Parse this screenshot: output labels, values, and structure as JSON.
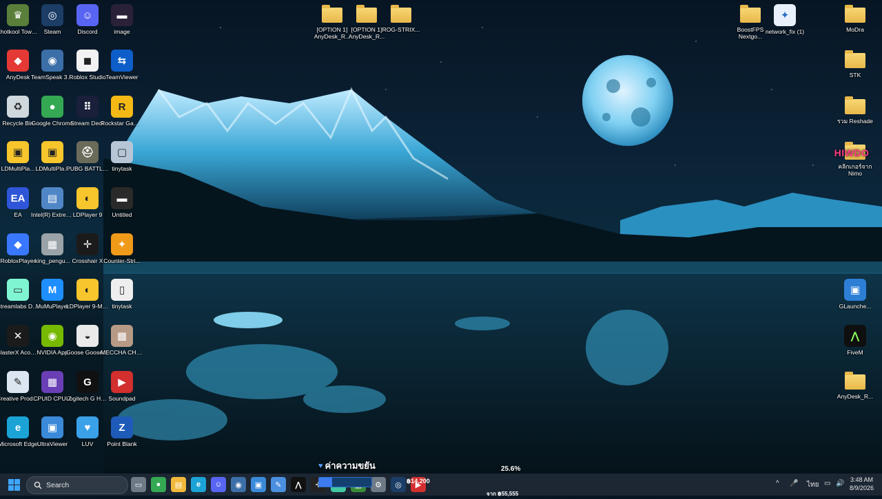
{
  "desktop_icons": [
    {
      "label": "Khotkool Town L...",
      "icon": "game-icon",
      "color": "#5a7f3a",
      "glyph": "♛"
    },
    {
      "label": "Steam",
      "icon": "steam-icon",
      "color": "#1b3d66",
      "glyph": "◎"
    },
    {
      "label": "Discord",
      "icon": "discord-icon",
      "color": "#5865f2",
      "glyph": "☺"
    },
    {
      "label": "image",
      "icon": "image-file-icon",
      "color": "#2a2138",
      "glyph": "▬"
    },
    {
      "label": "AnyDesk",
      "icon": "anydesk-icon",
      "color": "#e53935",
      "glyph": "◆"
    },
    {
      "label": "TeamSpeak 3 Client",
      "icon": "teamspeak-icon",
      "color": "#3c6fa8",
      "glyph": "◉"
    },
    {
      "label": "Roblox Studio",
      "icon": "roblox-studio-icon",
      "color": "#f2f2f2",
      "glyph": "◼"
    },
    {
      "label": "TeamViewer",
      "icon": "teamviewer-icon",
      "color": "#0e5ec9",
      "glyph": "⇆"
    },
    {
      "label": "Recycle Bin",
      "icon": "recycle-bin-icon",
      "color": "#cfd8dc",
      "glyph": "♻"
    },
    {
      "label": "Google Chrome",
      "icon": "chrome-icon",
      "color": "#34a853",
      "glyph": "●"
    },
    {
      "label": "Stream Deck",
      "icon": "stream-deck-icon",
      "color": "#1a1f3a",
      "glyph": "⠿"
    },
    {
      "label": "Rockstar Games...",
      "icon": "rockstar-icon",
      "color": "#f5b916",
      "glyph": "R"
    },
    {
      "label": "LDMultiPla...",
      "icon": "ldmultiplayer-icon",
      "color": "#f7c52c",
      "glyph": "▣"
    },
    {
      "label": "LDMultiPla...",
      "icon": "ldmultiplayer-icon",
      "color": "#f7c52c",
      "glyph": "▣"
    },
    {
      "label": "PUBG BATTLEGR...",
      "icon": "pubg-icon",
      "color": "#6b6b5a",
      "glyph": "⛑"
    },
    {
      "label": "tinytask",
      "icon": "tinytask-icon",
      "color": "#b6c6d6",
      "glyph": "▢"
    },
    {
      "label": "EA",
      "icon": "ea-icon",
      "color": "#2f56d8",
      "glyph": "EA"
    },
    {
      "label": "Intel(R) Extreme Tu...",
      "icon": "intel-xtu-icon",
      "color": "#4f86c6",
      "glyph": "▤"
    },
    {
      "label": "LDPlayer 9",
      "icon": "ldplayer-icon",
      "color": "#f7c52c",
      "glyph": "◐"
    },
    {
      "label": "Untitled",
      "icon": "image-file-icon",
      "color": "#2a2a2a",
      "glyph": "▬"
    },
    {
      "label": "RobloxPlayer",
      "icon": "roblox-icon",
      "color": "#3a77ff",
      "glyph": "◆"
    },
    {
      "label": "king_pengu...",
      "icon": "image-file-icon",
      "color": "#9aa3a8",
      "glyph": "▦"
    },
    {
      "label": "Crosshair X",
      "icon": "crosshair-icon",
      "color": "#1b1b1b",
      "glyph": "✛"
    },
    {
      "label": "Counter-Stri...",
      "icon": "counter-strike-icon",
      "color": "#f09a1a",
      "glyph": "✦"
    },
    {
      "label": "Streamlabs Desktop",
      "icon": "streamlabs-icon",
      "color": "#80f5d2",
      "glyph": "▭"
    },
    {
      "label": "MuMuPlayer",
      "icon": "mumu-icon",
      "color": "#1f8fff",
      "glyph": "M"
    },
    {
      "label": "LDPlayer 9-MoDra",
      "icon": "ldplayer-icon",
      "color": "#f7c52c",
      "glyph": "◐"
    },
    {
      "label": "tinytask",
      "icon": "file-icon",
      "color": "#eeeeee",
      "glyph": "▯"
    },
    {
      "label": "BlasterX Acoustic...",
      "icon": "blasterx-icon",
      "color": "#1b1b1b",
      "glyph": "✕"
    },
    {
      "label": "NVIDIA App",
      "icon": "nvidia-icon",
      "color": "#76b900",
      "glyph": "◉"
    },
    {
      "label": "Goose Goose Duck",
      "icon": "goose-icon",
      "color": "#eaeaea",
      "glyph": "◒"
    },
    {
      "label": "MECCHA CHAMELEON",
      "icon": "image-file-icon",
      "color": "#b79a86",
      "glyph": "▦"
    },
    {
      "label": "Creative Product R...",
      "icon": "creative-icon",
      "color": "#dbe6f1",
      "glyph": "✎"
    },
    {
      "label": "CPUID CPU-Z",
      "icon": "cpuz-icon",
      "color": "#6a3fb5",
      "glyph": "▦"
    },
    {
      "label": "Logitech G HUB",
      "icon": "logitech-icon",
      "color": "#111111",
      "glyph": "G"
    },
    {
      "label": "Soundpad",
      "icon": "soundpad-icon",
      "color": "#d32f2f",
      "glyph": "▶"
    },
    {
      "label": "Microsoft Edge",
      "icon": "edge-icon",
      "color": "#1ba3d6",
      "glyph": "e"
    },
    {
      "label": "UltraViewer",
      "icon": "ultraviewer-icon",
      "color": "#3b8ad9",
      "glyph": "▣"
    },
    {
      "label": "LUV",
      "icon": "luv-icon",
      "color": "#3aa0e8",
      "glyph": "♥"
    },
    {
      "label": "Point Blank",
      "icon": "point-blank-icon",
      "color": "#1e5bb8",
      "glyph": "Z"
    }
  ],
  "top_files": [
    {
      "label": "[OPTION 1] AnyDesk_R...",
      "icon": "folder-icon"
    },
    {
      "label": "[OPTION 1] AnyDesk_R...",
      "icon": "folder-icon"
    },
    {
      "label": "ROG-STRIX...",
      "icon": "folder-icon"
    },
    {
      "label": "BoostFPS Nextgo...",
      "icon": "folder-icon"
    },
    {
      "label": "network_fix (1)",
      "icon": "script-file-icon"
    }
  ],
  "right_icons": [
    {
      "label": "MoDra",
      "icon": "folder-icon"
    },
    {
      "label": "STK",
      "icon": "folder-icon"
    },
    {
      "label": "รวม Reshade",
      "icon": "folder-icon"
    },
    {
      "label": "คลิกเกอร์จาก Nimo",
      "icon": "folder-icon"
    },
    {
      "label": "GLaunche...",
      "icon": "game-launcher-icon"
    },
    {
      "label": "FiveM",
      "icon": "fivem-icon"
    },
    {
      "label": "AnyDesk_R...",
      "icon": "folder-icon"
    }
  ],
  "overlay_text": {
    "brand": "HIWDO"
  },
  "widget": {
    "title": "ค่าความขยัน",
    "heart": "♥",
    "percent": "25.6%",
    "amount": "฿14,200",
    "goal": "จาก ฿55,555",
    "progress": 0.256
  },
  "taskbar": {
    "search_placeholder": "Search",
    "apps": [
      "file-icon",
      "chrome-icon",
      "file-explorer-icon",
      "edge-icon",
      "discord-icon",
      "teamspeak-icon",
      "ultraviewer-icon",
      "notepad-icon",
      "fivem-icon",
      "crosshair-icon",
      "streamlabs-icon",
      "app-icon",
      "settings-icon",
      "steam-icon",
      "soundpad-icon"
    ],
    "tray": {
      "language": "ไทย",
      "chevron": "^"
    },
    "time": "3:48 AM",
    "date": "8/9/2026"
  }
}
